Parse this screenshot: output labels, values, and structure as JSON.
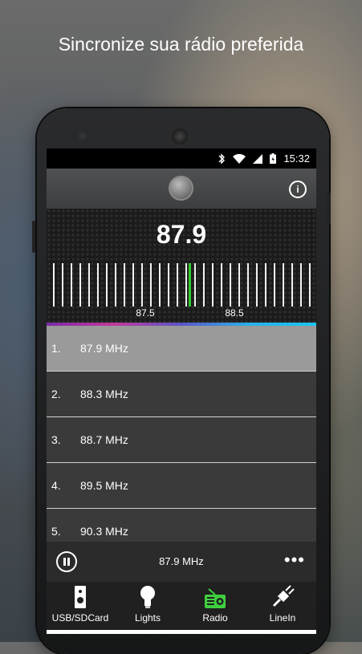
{
  "headline": "Sincronize sua rádio preferida",
  "status": {
    "time": "15:32"
  },
  "tuner": {
    "frequency": "87.9",
    "scale_left": "87.5",
    "scale_right": "88.5"
  },
  "stations": [
    {
      "num": "1.",
      "label": "87.9 MHz"
    },
    {
      "num": "2.",
      "label": "88.3 MHz"
    },
    {
      "num": "3.",
      "label": "88.7 MHz"
    },
    {
      "num": "4.",
      "label": "89.5 MHz"
    },
    {
      "num": "5.",
      "label": "90.3 MHz"
    }
  ],
  "player": {
    "now_playing": "87.9 MHz",
    "more": "•••"
  },
  "tabs": [
    {
      "label": "USB/SDCard",
      "icon": "speaker-icon"
    },
    {
      "label": "Lights",
      "icon": "bulb-icon"
    },
    {
      "label": "Radio",
      "icon": "radio-icon"
    },
    {
      "label": "LineIn",
      "icon": "plug-icon"
    }
  ],
  "colors": {
    "active_tab": "#3fcf3f",
    "tuner_needle": "#2ecc2e"
  }
}
